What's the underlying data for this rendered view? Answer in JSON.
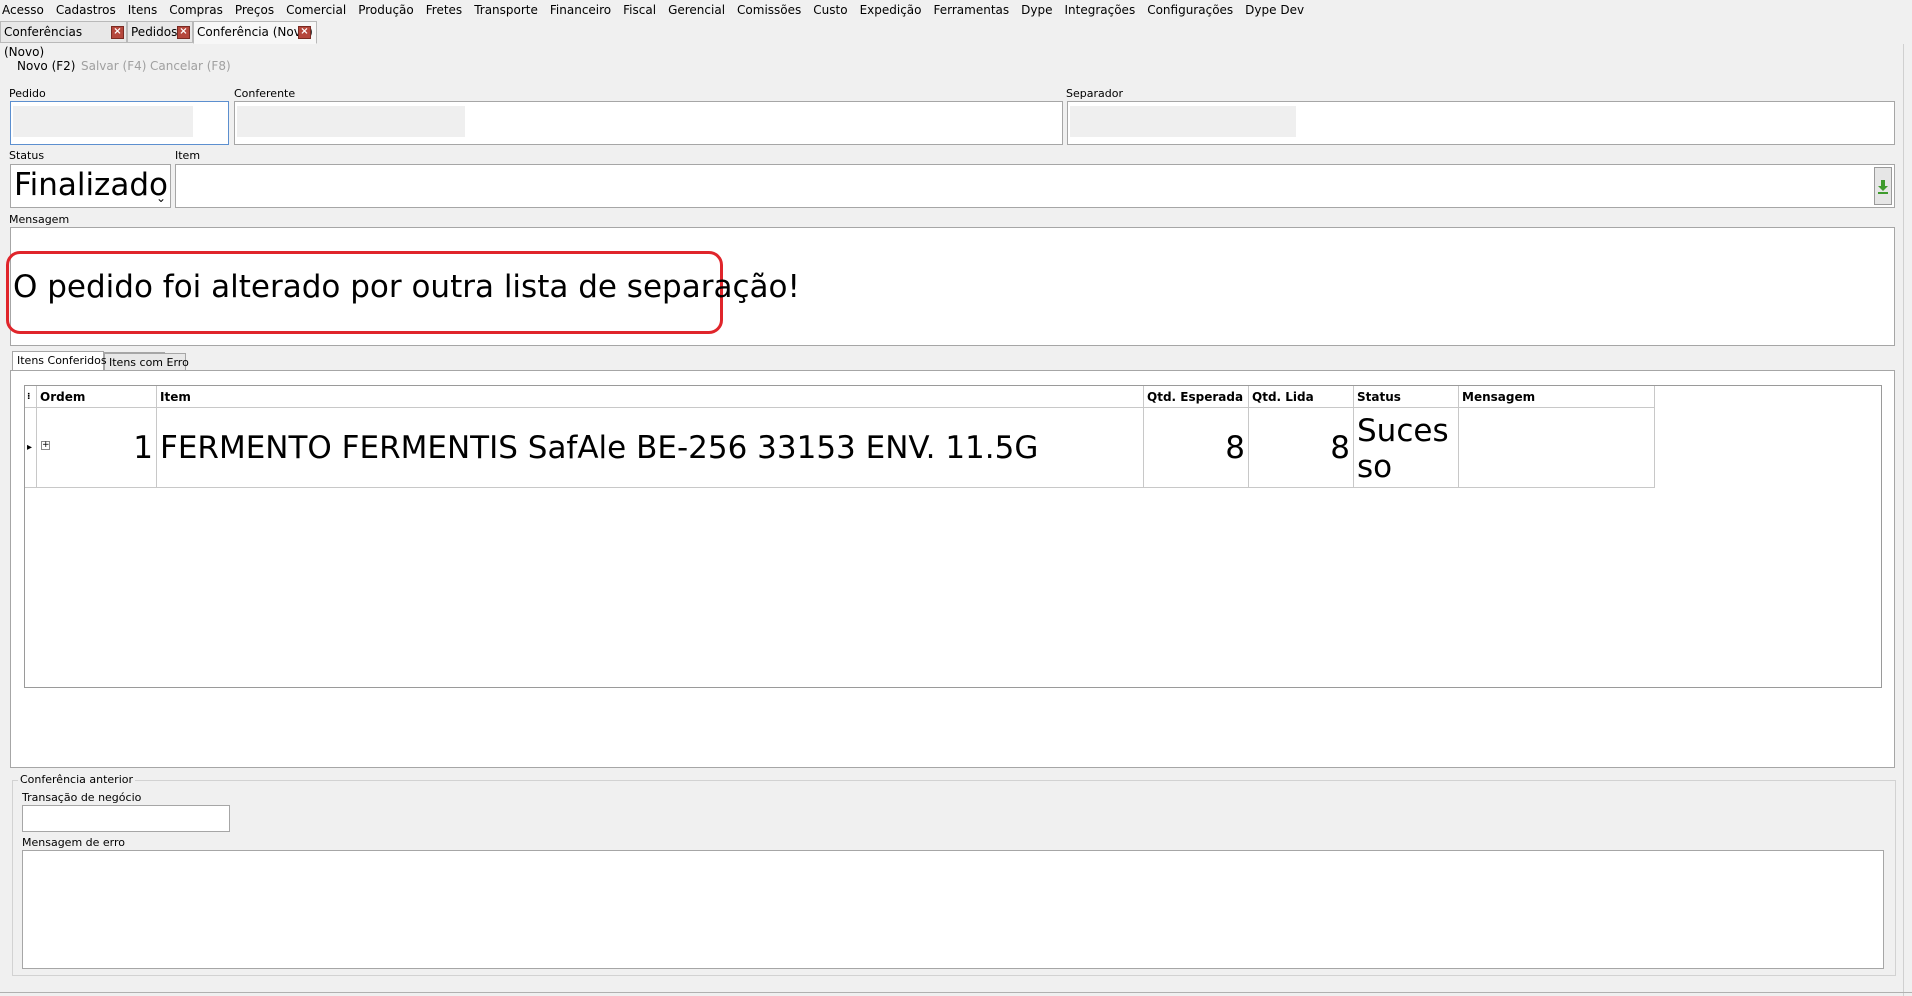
{
  "menu": [
    "Acesso",
    "Cadastros",
    "Itens",
    "Compras",
    "Preços",
    "Comercial",
    "Produção",
    "Fretes",
    "Transporte",
    "Financeiro",
    "Fiscal",
    "Gerencial",
    "Comissões",
    "Custo",
    "Expedição",
    "Ferramentas",
    "Dype",
    "Integrações",
    "Configurações",
    "Dype Dev"
  ],
  "doc_tabs": [
    {
      "label": "Conferências (Novo)",
      "active": false
    },
    {
      "label": "Pedidos",
      "active": false
    },
    {
      "label": "Conferência (Novo)",
      "active": true
    }
  ],
  "toolbar": {
    "novo": "Novo (F2)",
    "salvar": "Salvar (F4)",
    "cancelar": "Cancelar (F8)"
  },
  "form": {
    "pedido_label": "Pedido",
    "conferente_label": "Conferente",
    "separador_label": "Separador",
    "status_label": "Status",
    "status_value": "Finalizado",
    "item_label": "Item",
    "mensagem_label": "Mensagem",
    "mensagem_value": "O pedido foi alterado por outra lista de separação!"
  },
  "inner_tabs": [
    "Itens Conferidos",
    "Itens com Erro"
  ],
  "grid": {
    "columns": [
      "Ordem",
      "Item",
      "Qtd. Esperada",
      "Qtd. Lida",
      "Status",
      "Mensagem"
    ],
    "rows": [
      {
        "ordem": "1",
        "item": "FERMENTO FERMENTIS SafAle BE-256 33153 ENV. 11.5G",
        "qtd_esperada": "8",
        "qtd_lida": "8",
        "status": "Sucesso",
        "mensagem": ""
      }
    ]
  },
  "previous": {
    "group_label": "Conferência anterior",
    "transacao_label": "Transação de negócio",
    "erro_label": "Mensagem de erro"
  },
  "colors": {
    "highlight": "#e0252b",
    "focus_border": "#5c8fcf",
    "tab_close": "#b5473c"
  }
}
